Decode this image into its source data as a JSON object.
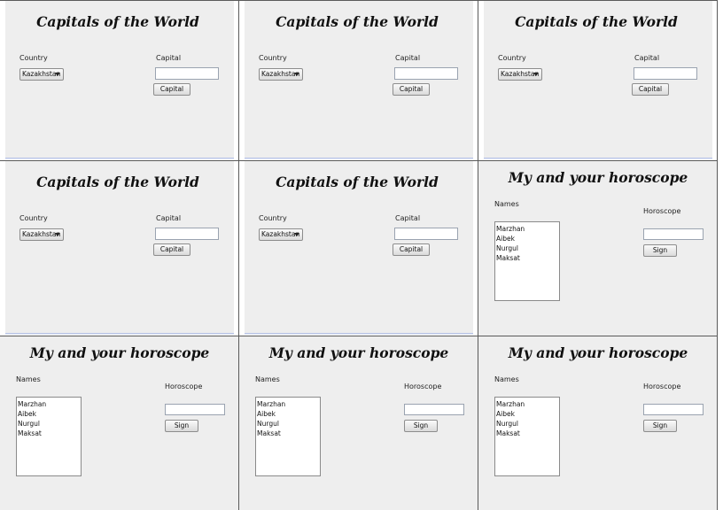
{
  "capitals_window": {
    "title": "Capitals of the World",
    "country_label": "Country",
    "country_selected": "Kazakhstan",
    "capital_label": "Capital",
    "capital_value": "",
    "capital_button": "Capital"
  },
  "horoscope_window": {
    "title": "My and your horoscope",
    "names_label": "Names",
    "names": [
      "Marzhan",
      "Aibek",
      "Nurgul",
      "Maksat"
    ],
    "horoscope_label": "Horoscope",
    "horoscope_value": "",
    "sign_button": "Sign"
  },
  "colors": {
    "window_background": "#eeeeee",
    "grid_line": "#5a5a5a"
  }
}
